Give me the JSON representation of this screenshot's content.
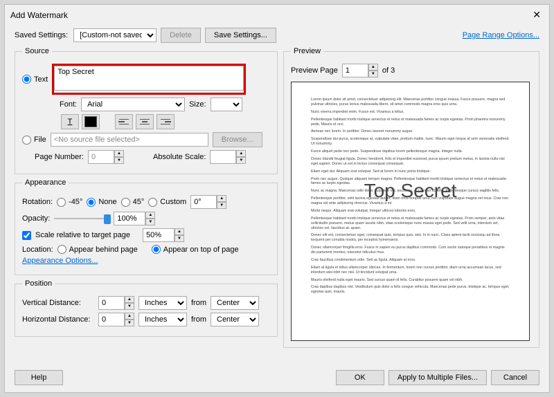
{
  "title": "Add Watermark",
  "toprow": {
    "saved_settings_label": "Saved Settings:",
    "saved_settings_value": "[Custom-not saved]",
    "delete": "Delete",
    "save": "Save Settings...",
    "page_range": "Page Range Options..."
  },
  "source": {
    "legend": "Source",
    "text_label": "Text",
    "text_value": "Top Secret",
    "font_label": "Font:",
    "font_value": "Arial",
    "size_label": "Size:",
    "size_value": "",
    "file_label": "File",
    "file_value": "<No source file selected>",
    "browse": "Browse...",
    "page_number_label": "Page Number:",
    "page_number_value": "0",
    "abs_scale_label": "Absolute Scale:",
    "abs_scale_value": ""
  },
  "appearance": {
    "legend": "Appearance",
    "rotation_label": "Rotation:",
    "rot_m45": "-45°",
    "rot_none": "None",
    "rot_45": "45°",
    "rot_custom": "Custom",
    "rot_custom_value": "0°",
    "opacity_label": "Opacity:",
    "opacity_value": "100%",
    "scale_rel_label": "Scale relative to target page",
    "scale_rel_value": "50%",
    "location_label": "Location:",
    "loc_behind": "Appear behind page",
    "loc_top": "Appear on top of page",
    "appearance_options": "Appearance Options..."
  },
  "position": {
    "legend": "Position",
    "vdist_label": "Vertical Distance:",
    "hdist_label": "Horizontal Distance:",
    "value": "0",
    "unit": "Inches",
    "from_label": "from",
    "from_value": "Center"
  },
  "preview": {
    "legend": "Preview",
    "page_label": "Preview Page",
    "page_value": "1",
    "of_label": "of 3",
    "watermark_text": "Top Secret"
  },
  "footer": {
    "help": "Help",
    "ok": "OK",
    "apply_multi": "Apply to Multiple Files...",
    "cancel": "Cancel"
  }
}
